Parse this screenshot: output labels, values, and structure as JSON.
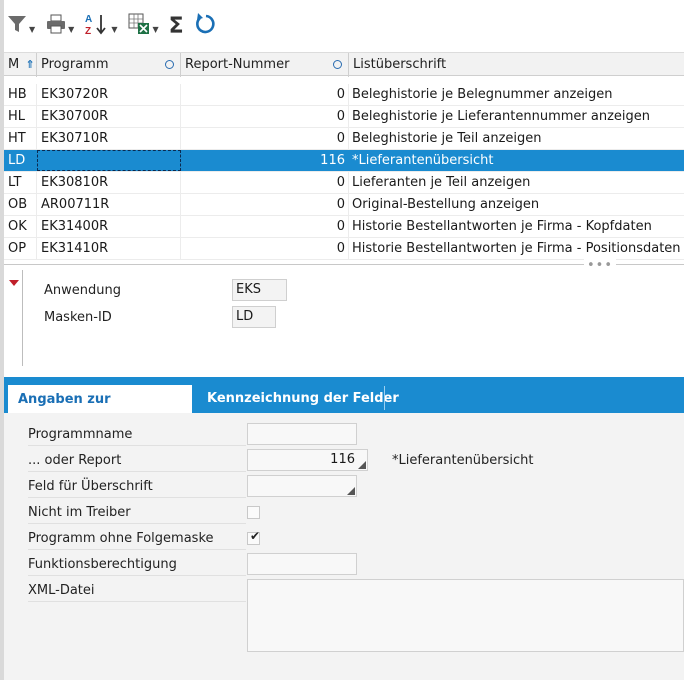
{
  "toolbar": {
    "icons": [
      "filter-icon",
      "print-icon",
      "sort-az-icon",
      "excel-export-icon",
      "sum-icon",
      "refresh-icon"
    ]
  },
  "grid": {
    "headers": {
      "m": "M",
      "programm": "Programm",
      "report": "Report-Nummer",
      "titel": "Listüberschrift"
    },
    "rows": [
      {
        "m": "HB",
        "programm": "EK30720R",
        "report": "0",
        "titel": "Beleghistorie je Belegnummer anzeigen"
      },
      {
        "m": "HL",
        "programm": "EK30700R",
        "report": "0",
        "titel": "Beleghistorie je Lieferantennummer anzeigen"
      },
      {
        "m": "HT",
        "programm": "EK30710R",
        "report": "0",
        "titel": "Beleghistorie je Teil anzeigen"
      },
      {
        "m": "LD",
        "programm": "",
        "report": "116",
        "titel": "*Lieferantenübersicht"
      },
      {
        "m": "LT",
        "programm": "EK30810R",
        "report": "0",
        "titel": "Lieferanten je Teil anzeigen"
      },
      {
        "m": "OB",
        "programm": "AR00711R",
        "report": "0",
        "titel": "Original-Bestellung anzeigen"
      },
      {
        "m": "OK",
        "programm": "EK31400R",
        "report": "0",
        "titel": "Historie Bestellantworten je Firma - Kopfdaten"
      },
      {
        "m": "OP",
        "programm": "EK31410R",
        "report": "0",
        "titel": "Historie Bestellantworten je Firma - Positionsdaten"
      }
    ],
    "selected_index": 3
  },
  "detail": {
    "anwendung_label": "Anwendung",
    "anwendung_value": "EKS",
    "masken_label": "Masken-ID",
    "masken_value": "LD"
  },
  "tabs": [
    {
      "label": "Angaben zur Folgemaske",
      "active": true
    },
    {
      "label": "Kennzeichnung der Felder",
      "active": false
    }
  ],
  "form": {
    "programmname_label": "Programmname",
    "programmname_value": "",
    "report_label": "... oder Report",
    "report_value": "116",
    "report_title": "*Lieferantenübersicht",
    "feld_label": "Feld für Überschrift",
    "feld_value": "",
    "nicht_label": "Nicht im Treiber",
    "nicht_checked": false,
    "ohne_label": "Programm ohne Folgemaske",
    "ohne_checked": true,
    "funktion_label": "Funktionsberechtigung",
    "funktion_value": "",
    "xml_label": "XML-Datei",
    "xml_value": ""
  },
  "colors": {
    "accent": "#1a8bd0",
    "selected_row": "#1a8bd0",
    "tab_active_text": "#1a6fb5"
  }
}
